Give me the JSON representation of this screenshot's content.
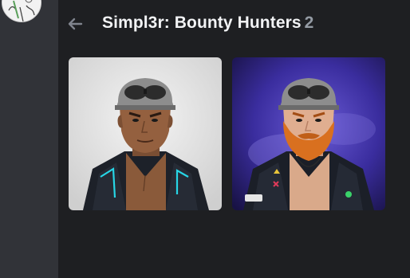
{
  "header": {
    "back_icon": "arrow-left-icon",
    "title": "Simpl3r: Bounty Hunters",
    "count": "2"
  },
  "avatar": {
    "icon": "user-avatar"
  },
  "gallery": {
    "items": [
      {
        "kind": "nft-character-portrait",
        "variant": "clean-shaven",
        "background": "light-gray"
      },
      {
        "kind": "nft-character-portrait",
        "variant": "ginger-beard",
        "background": "purple-smoke"
      }
    ]
  },
  "colors": {
    "panel_bg": "#1e1f22",
    "app_bg": "#313338",
    "title_text": "#f2f3f5",
    "count_text": "#949ba4",
    "accent_cyan": "#27d6e6"
  }
}
